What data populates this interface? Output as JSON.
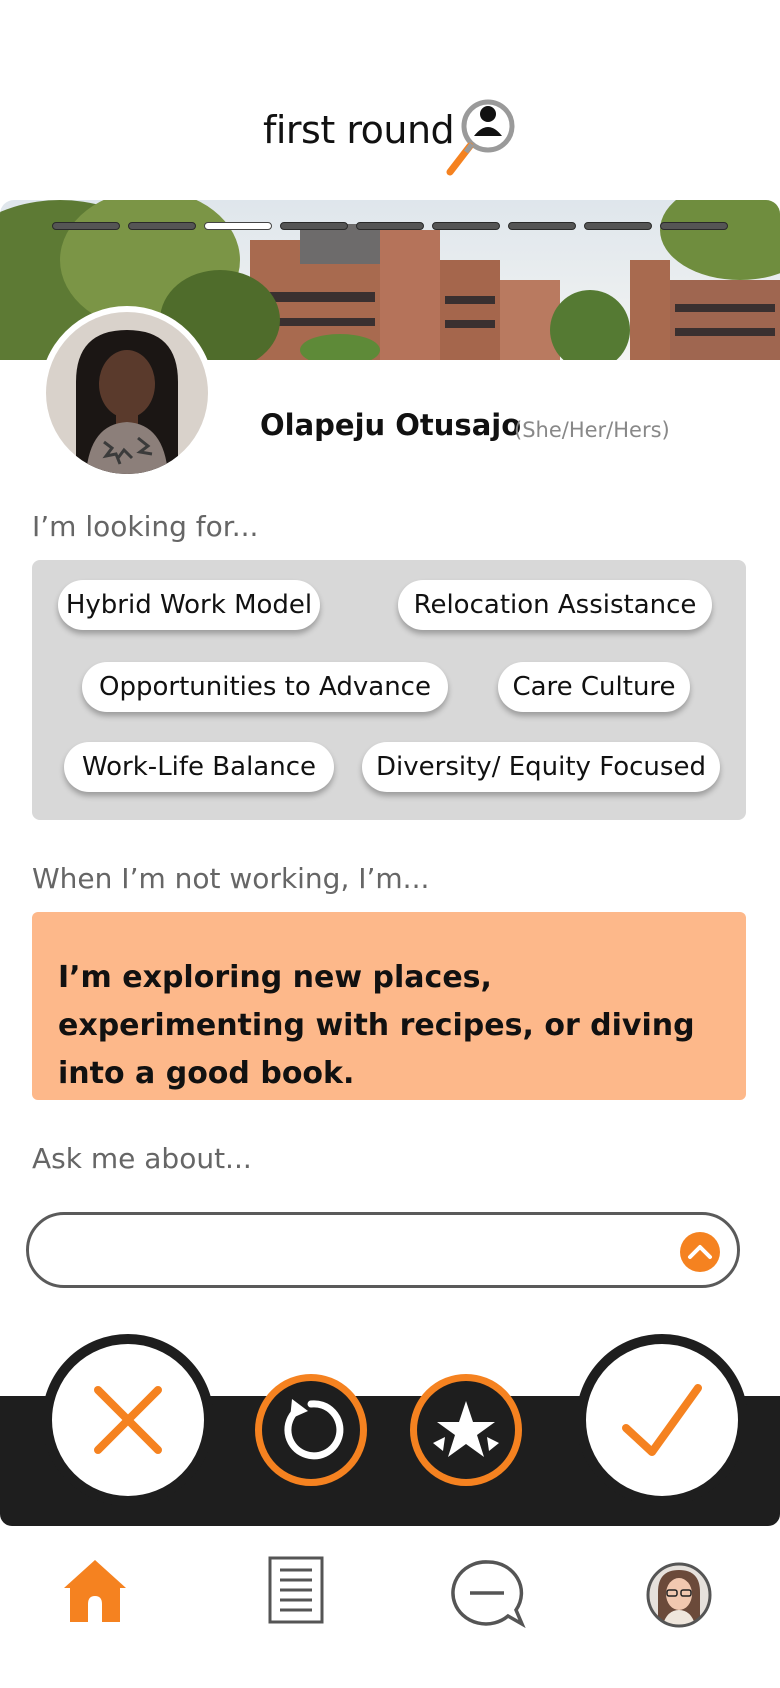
{
  "app": {
    "name": "first round"
  },
  "progress": {
    "total": 9,
    "current": 3
  },
  "profile": {
    "name": "Olapeju Otusajo",
    "pronouns": "(She/Her/Hers)"
  },
  "looking_for": {
    "label": "I’m looking for...",
    "tags": [
      "Hybrid Work Model",
      "Relocation Assistance",
      "Opportunities to Advance",
      "Care Culture",
      "Work-Life Balance",
      "Diversity/ Equity Focused"
    ]
  },
  "not_working": {
    "label": "When I’m not working, I’m...",
    "text": "I’m exploring new places, experimenting with recipes, or diving into a good book."
  },
  "ask": {
    "label": "Ask me about...",
    "value": "",
    "placeholder": ""
  },
  "actions": {
    "reject": "x-icon",
    "undo": "undo-icon",
    "superlike": "star-icon",
    "accept": "check-icon"
  },
  "nav": {
    "items": [
      "home-icon",
      "document-icon",
      "chat-icon",
      "profile-avatar"
    ],
    "active": "home-icon"
  },
  "colors": {
    "accent": "#f58220",
    "peach": "#fdb88a",
    "dark_bar": "#1e1e1e",
    "tag_panel": "#d8d8d8"
  }
}
